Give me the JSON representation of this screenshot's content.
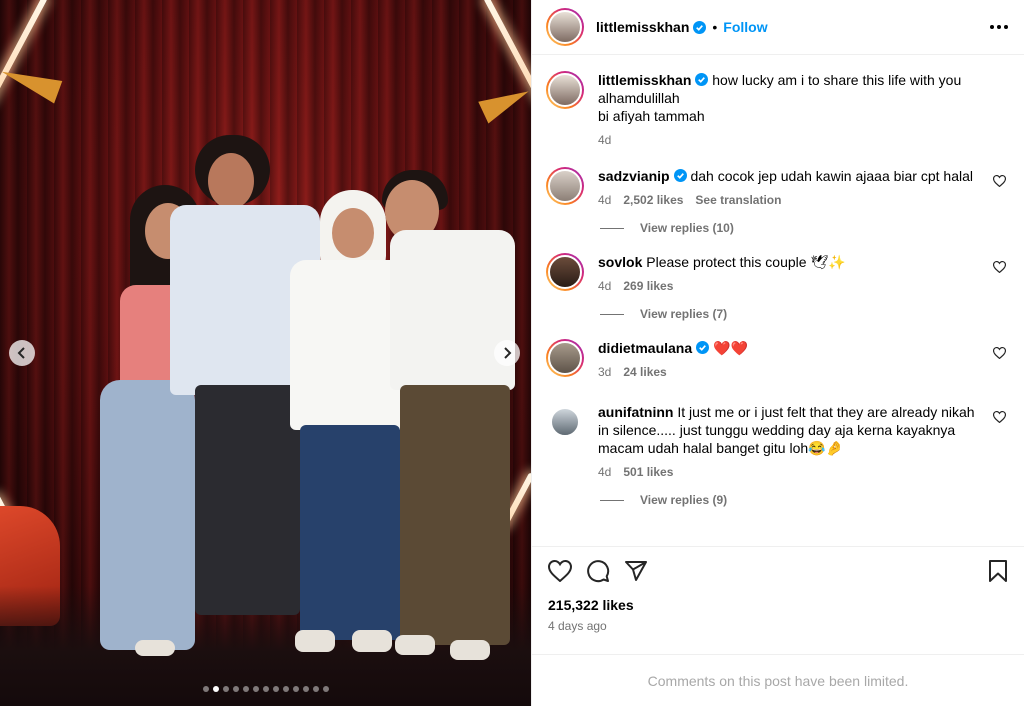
{
  "post": {
    "author": "littlemisskhan",
    "follow_label": "Follow",
    "bullet": "•",
    "caption_lines": [
      "how lucky am i to share this life with you",
      "alhamdulillah",
      "bi afiyah tammah"
    ],
    "caption_age": "4d"
  },
  "comments": [
    {
      "user": "sadzvianip",
      "verified": true,
      "text": "dah cocok jep udah kawin ajaaa biar cpt halal",
      "age": "4d",
      "likes": "2,502 likes",
      "extra": "See translation",
      "replies": "View replies (10)"
    },
    {
      "user": "sovlok",
      "verified": false,
      "text": "Please protect this couple 🕊✨",
      "age": "4d",
      "likes": "269 likes",
      "extra": "",
      "replies": "View replies (7)"
    },
    {
      "user": "didietmaulana",
      "verified": true,
      "text": "❤️❤️",
      "age": "3d",
      "likes": "24 likes",
      "extra": "",
      "replies": ""
    },
    {
      "user": "aunifatninn",
      "verified": false,
      "text": "It just me or i just felt that they are already nikah in silence..... just tunggu wedding day aja kerna kayaknya macam udah halal banget gitu loh😂🤌",
      "age": "4d",
      "likes": "501 likes",
      "extra": "",
      "replies": "View replies (9)"
    }
  ],
  "stats": {
    "likes": "215,322 likes",
    "date": "4 days ago"
  },
  "footer": {
    "limited": "Comments on this post have been limited."
  },
  "carousel": {
    "total_slides": 13,
    "active_slide": 2
  },
  "icons": {
    "like": "heart-icon",
    "comment": "comment-icon",
    "share": "share-icon",
    "save": "bookmark-icon",
    "prev": "chevron-left-icon",
    "next": "chevron-right-icon",
    "more": "more-icon"
  },
  "colors": {
    "link": "#0095f6",
    "verified": "#0095f6",
    "muted": "#737373"
  }
}
